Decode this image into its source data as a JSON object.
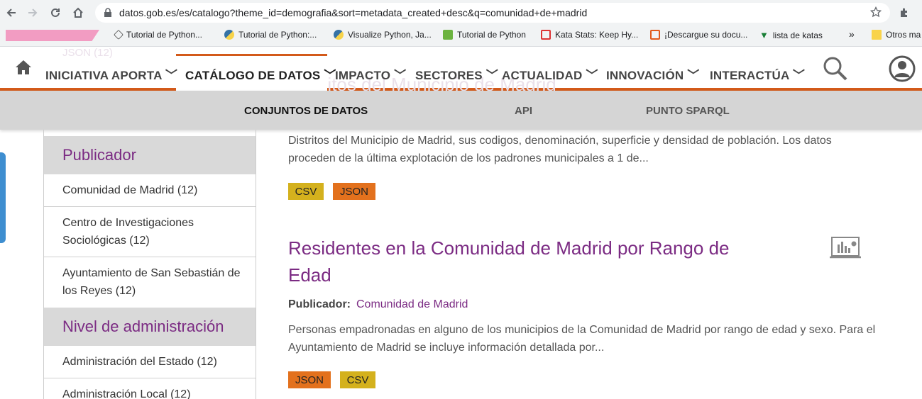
{
  "browser": {
    "url": "datos.gob.es/es/catalogo?theme_id=demografia&sort=metadata_created+desc&q=comunidad+de+madrid",
    "bookmarks": [
      {
        "label": "Tutorial de Python..."
      },
      {
        "label": "Tutorial de Python:..."
      },
      {
        "label": "Visualize Python, Ja..."
      },
      {
        "label": "Tutorial de Python"
      },
      {
        "label": "Kata Stats: Keep Hy..."
      },
      {
        "label": "¡Descargue su docu..."
      },
      {
        "label": "lista de katas"
      },
      {
        "label": "»"
      },
      {
        "label": "Otros ma"
      }
    ]
  },
  "ghost": {
    "json_count": "JSON (12)",
    "prev_title": "Distritos del Municipio de Madrid"
  },
  "nav": {
    "items": [
      {
        "label": "INICIATIVA APORTA"
      },
      {
        "label": "CATÁLOGO DE DATOS"
      },
      {
        "label": "IMPACTO"
      },
      {
        "label": "SECTORES"
      },
      {
        "label": "ACTUALIDAD"
      },
      {
        "label": "INNOVACIÓN"
      },
      {
        "label": "INTERACTÚA"
      }
    ],
    "active_index": 1
  },
  "subnav": {
    "items": [
      {
        "label": "CONJUNTOS DE DATOS"
      },
      {
        "label": "API"
      },
      {
        "label": "PUNTO SPARQL"
      }
    ]
  },
  "sidebar": {
    "publicador": {
      "title": "Publicador",
      "items": [
        {
          "label": "Comunidad de Madrid (12)"
        },
        {
          "label": "Centro de Investigaciones Sociológicas (12)"
        },
        {
          "label": "Ayuntamiento de San Sebastián de los Reyes (12)"
        }
      ]
    },
    "nivel": {
      "title": "Nivel de administración",
      "items": [
        {
          "label": "Administración del Estado (12)"
        },
        {
          "label": "Administración Local (12)"
        }
      ]
    }
  },
  "results": [
    {
      "description": "Distritos del Municipio de Madrid, sus codigos, denominación, superficie y densidad de población. Los datos proceden de la última explotación de los padrones municipales a 1 de...",
      "formats": [
        "CSV",
        "JSON"
      ]
    },
    {
      "title": "Residentes en la Comunidad de Madrid por Rango de Edad",
      "publisher_label": "Publicador:",
      "publisher": "Comunidad de Madrid",
      "description": "Personas empadronadas en alguno de los municipios de la Comunidad de Madrid por rango de edad y sexo. Para el Ayuntamiento de Madrid se incluye información detallada por...",
      "formats": [
        "JSON",
        "CSV"
      ]
    }
  ],
  "colors": {
    "accent_orange": "#d35a1a",
    "purple": "#7b2b83",
    "csv": "#d4b11d",
    "json": "#e3711d"
  }
}
